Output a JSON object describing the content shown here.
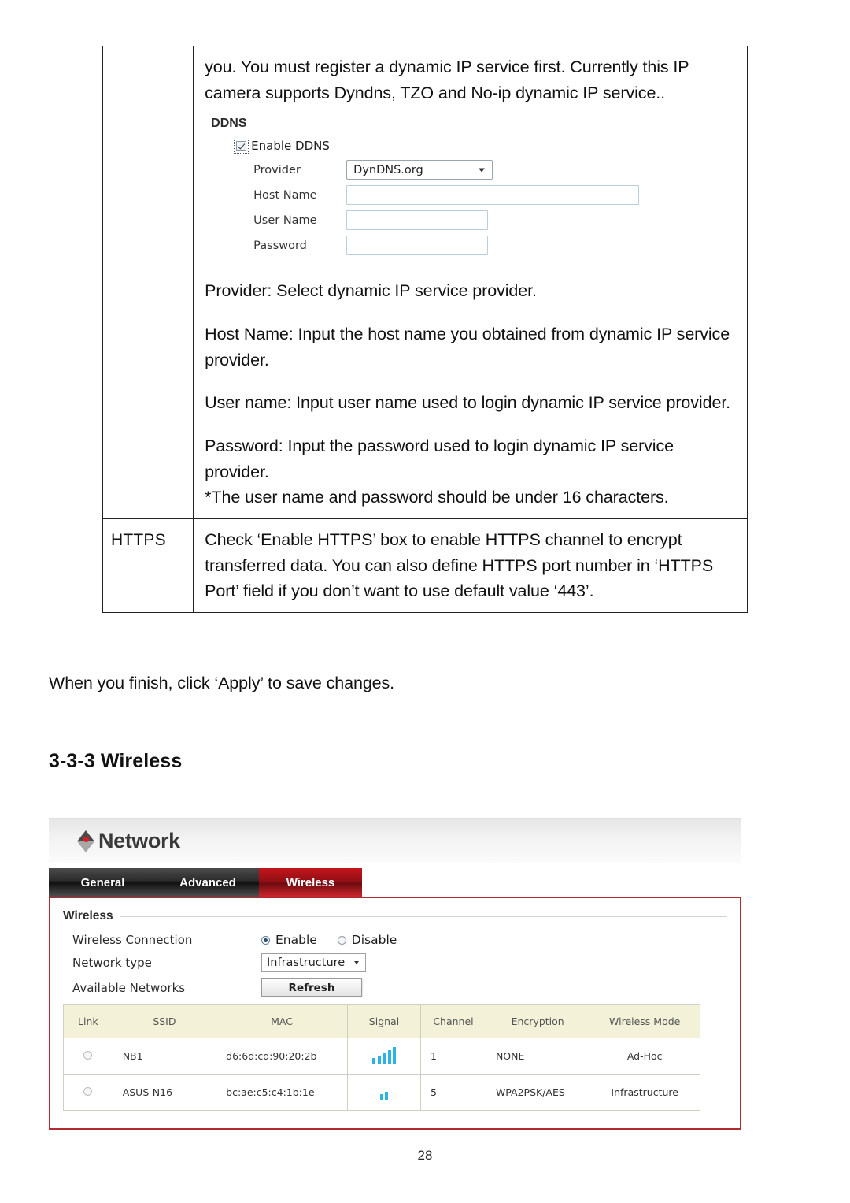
{
  "document": {
    "page_number": "28",
    "table": {
      "rows": [
        {
          "label": "",
          "paragraphs": [
            "you. You must register a dynamic IP service first. Currently this IP camera supports Dyndns, TZO and No-ip dynamic IP service..",
            "Provider: Select dynamic IP service provider.",
            "Host Name: Input the host name you obtained from dynamic IP service provider.",
            "User name: Input user name used to login dynamic IP service provider.",
            "Password: Input the password used to login dynamic IP service provider.",
            "*The user name and password should be under 16 characters."
          ]
        },
        {
          "label": "HTTPS",
          "paragraphs": [
            "Check ‘Enable HTTPS’ box to enable HTTPS channel to encrypt transferred data. You can also define HTTPS port number in ‘HTTPS Port’ field if you don’t want to use default value ‘443’."
          ]
        }
      ]
    },
    "ddns_panel": {
      "legend": "DDNS",
      "enable_checkbox": {
        "label": "Enable DDNS",
        "checked": true
      },
      "fields": [
        {
          "label": "Provider",
          "type": "select",
          "value": "DynDNS.org",
          "placeholder": ""
        },
        {
          "label": "Host Name",
          "type": "text",
          "value": "",
          "placeholder": ""
        },
        {
          "label": "User Name",
          "type": "text",
          "value": "",
          "placeholder": ""
        },
        {
          "label": "Password",
          "type": "text",
          "value": "",
          "placeholder": ""
        }
      ]
    },
    "apply_note": "When you finish, click ‘Apply’ to save changes.",
    "section_heading": "3-3-3 Wireless"
  },
  "screenshot": {
    "header": {
      "title": "Network",
      "logo_icon": "diamond-dot-logo-icon",
      "accent_color": "#d61f26"
    },
    "tabs": [
      {
        "label": "General",
        "active": false
      },
      {
        "label": "Advanced",
        "active": false
      },
      {
        "label": "Wireless",
        "active": true
      }
    ],
    "panel": {
      "legend": "Wireless",
      "rows": [
        {
          "label": "Wireless Connection",
          "control": "radio",
          "options": [
            {
              "label": "Enable",
              "selected": true
            },
            {
              "label": "Disable",
              "selected": false
            }
          ]
        },
        {
          "label": "Network type",
          "control": "select",
          "value": "Infrastructure"
        },
        {
          "label": "Available Networks",
          "control": "button",
          "value": "Refresh"
        }
      ],
      "networks_table": {
        "columns": [
          "Link",
          "SSID",
          "MAC",
          "Signal",
          "Channel",
          "Encryption",
          "Wireless Mode"
        ],
        "rows": [
          {
            "link_selected": false,
            "ssid": "NB1",
            "mac": "d6:6d:cd:90:20:2b",
            "signal_bars": 5,
            "channel": "1",
            "encryption": "NONE",
            "wireless_mode": "Ad-Hoc"
          },
          {
            "link_selected": false,
            "ssid": "ASUS-N16",
            "mac": "bc:ae:c5:c4:1b:1e",
            "signal_bars": 2,
            "channel": "5",
            "encryption": "WPA2PSK/AES",
            "wireless_mode": "Infrastructure"
          }
        ],
        "signal_bar_color": "#2bb3e8",
        "header_background": "#f3f2d8"
      }
    }
  }
}
